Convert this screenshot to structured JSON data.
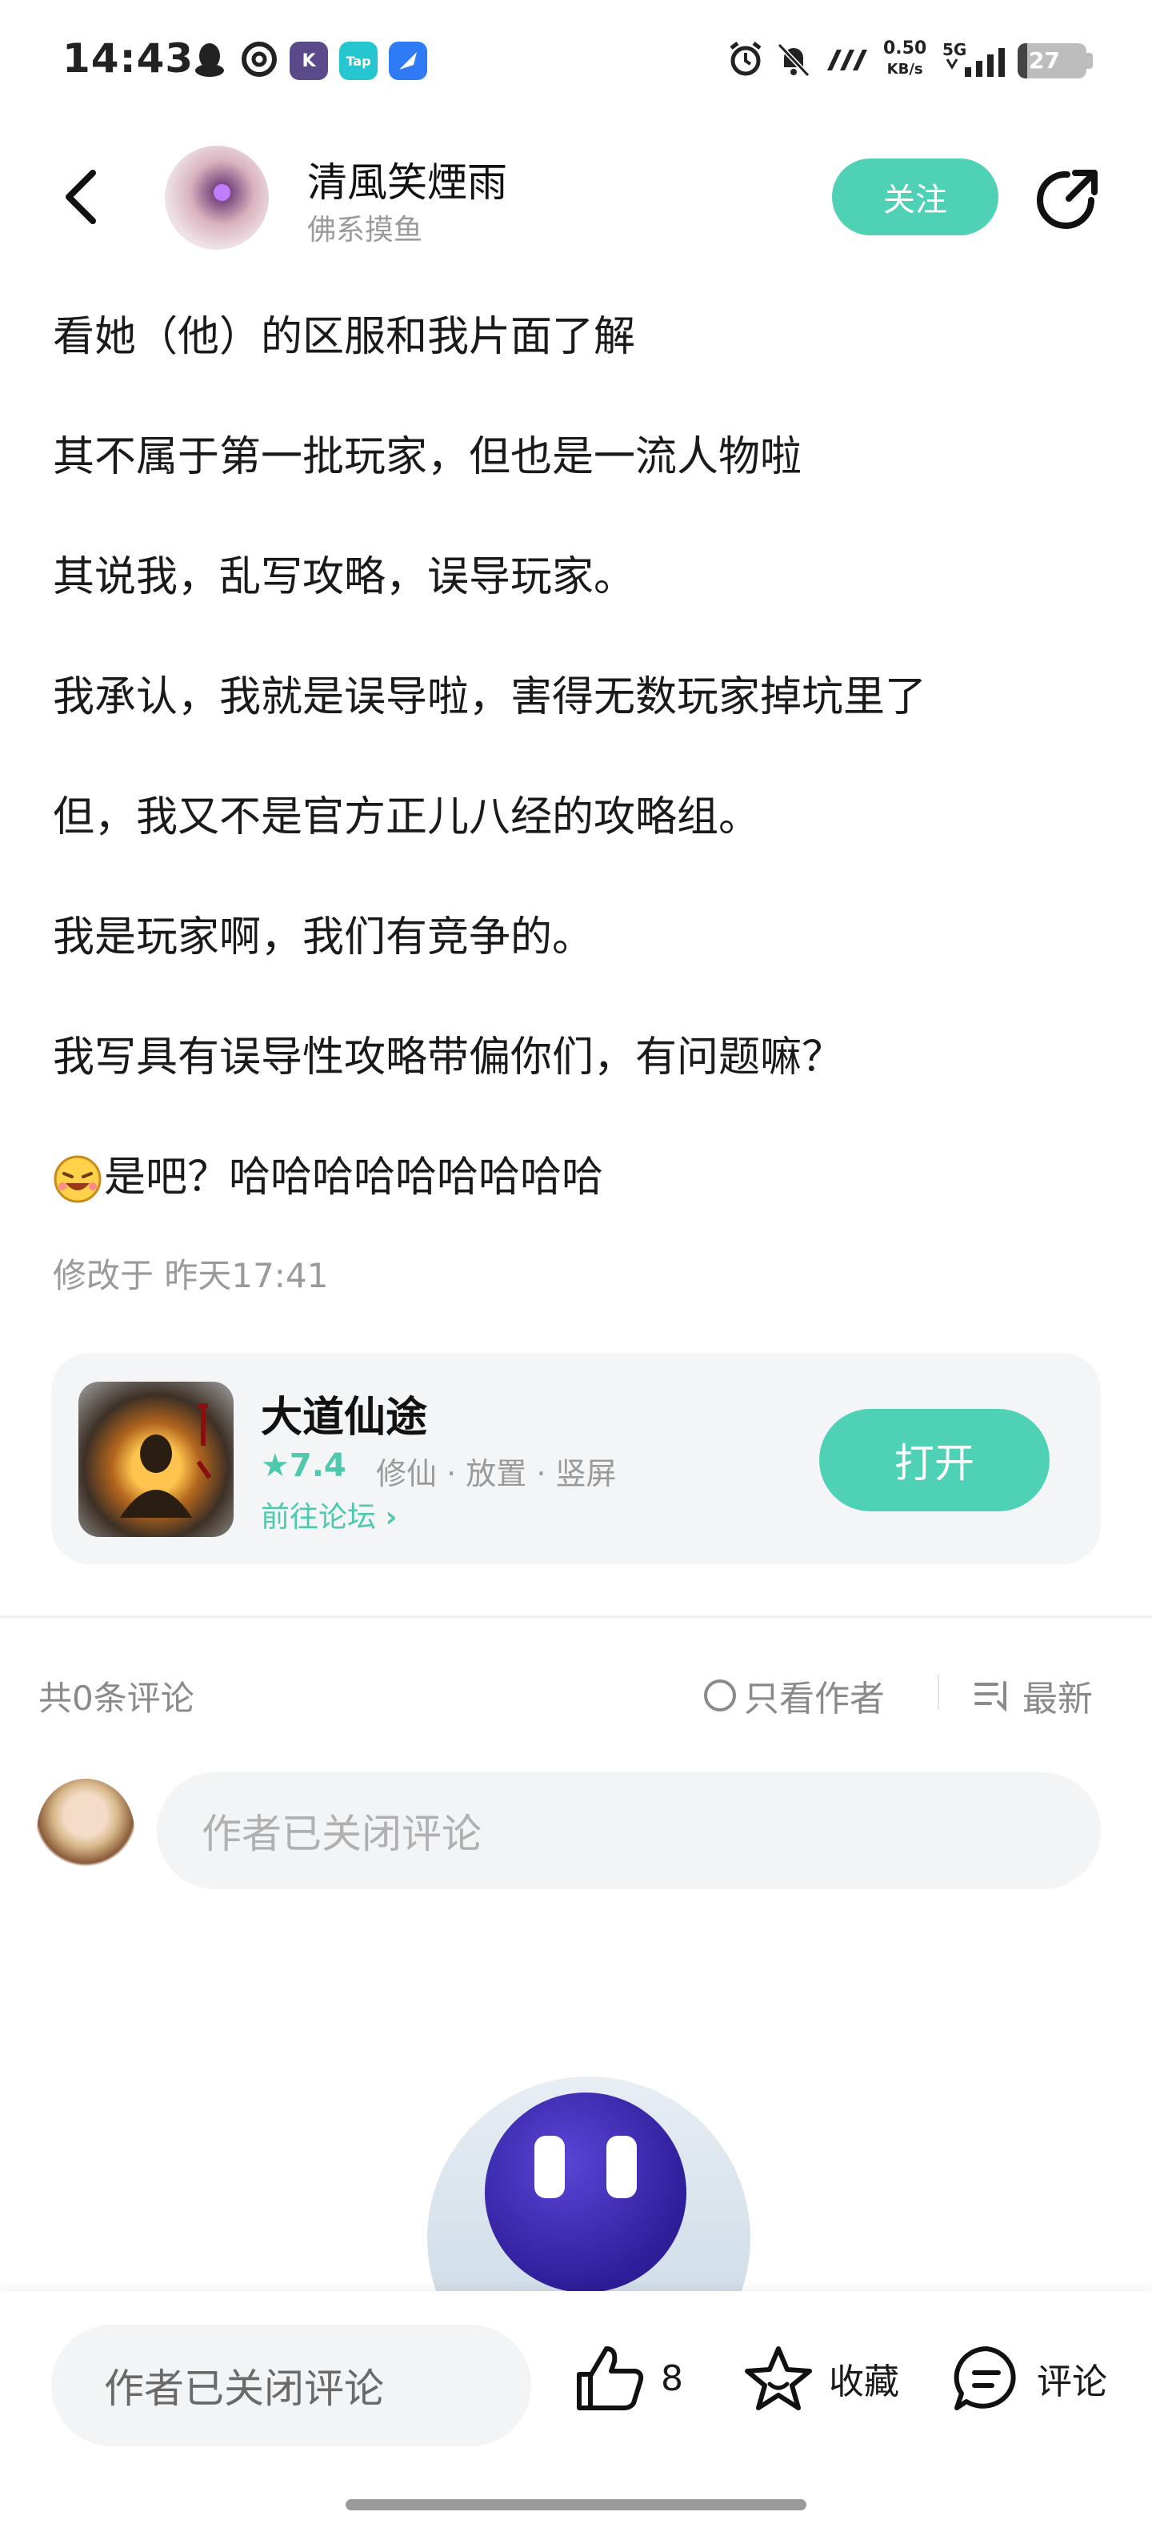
{
  "status_bar": {
    "time": "14:43",
    "net_speed_value": "0.50",
    "net_speed_unit": "KB/s",
    "network": "5G",
    "battery": "27",
    "app_icons": [
      "qq-icon",
      "netease-music-icon",
      "k-app-icon",
      "taptap-icon",
      "feather-app-icon"
    ]
  },
  "header": {
    "author_name": "清風笑煙雨",
    "author_subtitle": "佛系摸鱼",
    "follow_label": "关注"
  },
  "post": {
    "lines": [
      "看她（他）的区服和我片面了解",
      "其不属于第一批玩家，但也是一流人物啦",
      "其说我，乱写攻略，误导玩家。",
      "我承认，我就是误导啦，害得无数玩家掉坑里了",
      "但，我又不是官方正儿八经的攻略组。",
      "我是玩家啊，我们有竞争的。",
      "我写具有误导性攻略带偏你们，有问题嘛？",
      "是吧？哈哈哈哈哈哈哈哈哈"
    ],
    "edited": "修改于 昨天17:41"
  },
  "game_card": {
    "name": "大道仙途",
    "rating": "7.4",
    "tags": "修仙 · 放置 · 竖屏",
    "forum_link": "前往论坛",
    "open_label": "打开"
  },
  "comments": {
    "count_label": "共0条评论",
    "author_only_label": "只看作者",
    "sort_label": "最新",
    "input_placeholder": "作者已关闭评论"
  },
  "bottom_bar": {
    "input_placeholder": "作者已关闭评论",
    "like_count": "8",
    "favorite_label": "收藏",
    "comment_label": "评论"
  },
  "colors": {
    "accent": "#4fd1b6",
    "text_primary": "#1a1a1a",
    "text_secondary": "#9a9a9a",
    "card_bg": "#f4f5f6"
  }
}
